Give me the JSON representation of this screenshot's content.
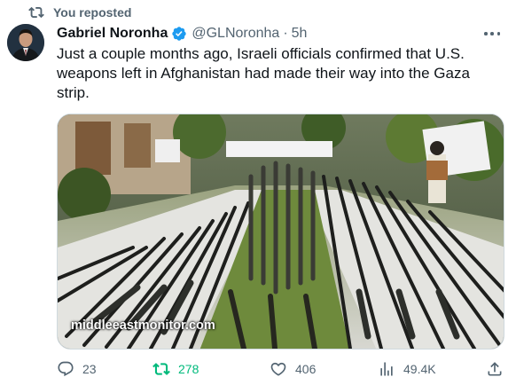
{
  "repost": {
    "label": "You reposted"
  },
  "tweet": {
    "author_name": "Gabriel Noronha",
    "handle": "@GLNoronha",
    "separator": "·",
    "time": "5h",
    "text": "Just a couple months ago, Israeli officials confirmed that U.S. weapons left in Afghanistan had made their way into the Gaza strip.",
    "media_watermark": "middleeastmonitor.com"
  },
  "actions": {
    "replies": "23",
    "reposts": "278",
    "likes": "406",
    "views": "49.4K",
    "reposted_by_viewer": true
  },
  "colors": {
    "text": "#0f1419",
    "secondary": "#536471",
    "verified": "#1d9bf0",
    "repost_active": "#00ba7c"
  },
  "icons": [
    "repost-icon",
    "verified-badge-icon",
    "more-icon",
    "reply-icon",
    "repost-icon",
    "like-icon",
    "views-icon",
    "share-icon"
  ]
}
